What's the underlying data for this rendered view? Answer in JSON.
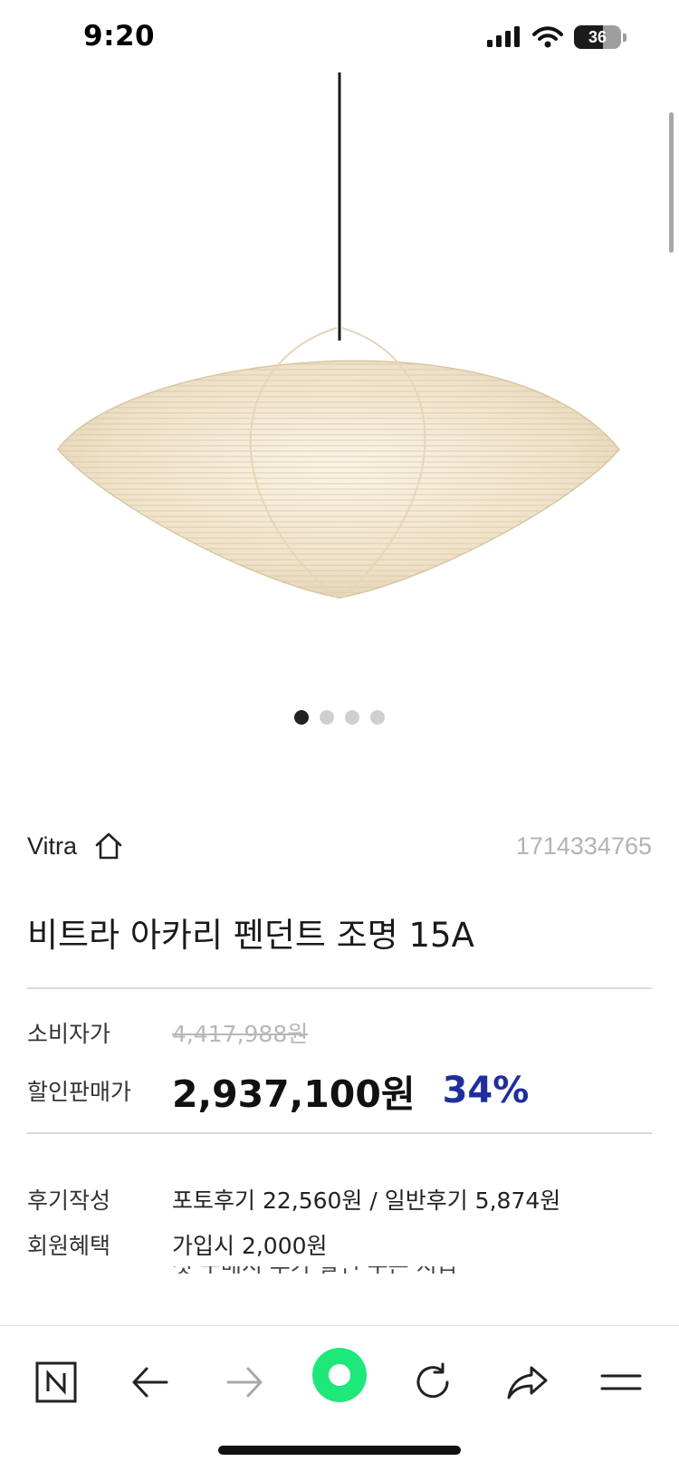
{
  "status_bar": {
    "time": "9:20",
    "battery_level": "36",
    "icons": [
      "cellular-signal-icon",
      "wifi-icon",
      "battery-icon"
    ]
  },
  "carousel": {
    "total": 4,
    "active_index": 0
  },
  "product": {
    "brand": "Vitra",
    "code": "1714334765",
    "title": "비트라 아카리 펜던트 조명 15A"
  },
  "pricing": {
    "consumer_label": "소비자가",
    "consumer_price": "4,417,988원",
    "sale_label": "할인판매가",
    "sale_price": "2,937,100원",
    "discount_rate": "34%"
  },
  "benefits": {
    "review_label": "후기작성",
    "review_value": "포토후기 22,560원 / 일반후기 5,874원",
    "member_label": "회원혜택",
    "member_value": "가입시 2,000원",
    "member_value_2": "첫 구매시 추가 할인 쿠폰 지급"
  },
  "toolbar": {
    "items": [
      "naver-n-icon",
      "back-arrow-icon",
      "forward-arrow-icon",
      "green-dot-icon",
      "reload-icon",
      "share-icon",
      "menu-icon"
    ]
  },
  "colors": {
    "discount": "#1e2f9d",
    "green_button": "#1ee87a",
    "muted_text": "#b3b3b3"
  }
}
